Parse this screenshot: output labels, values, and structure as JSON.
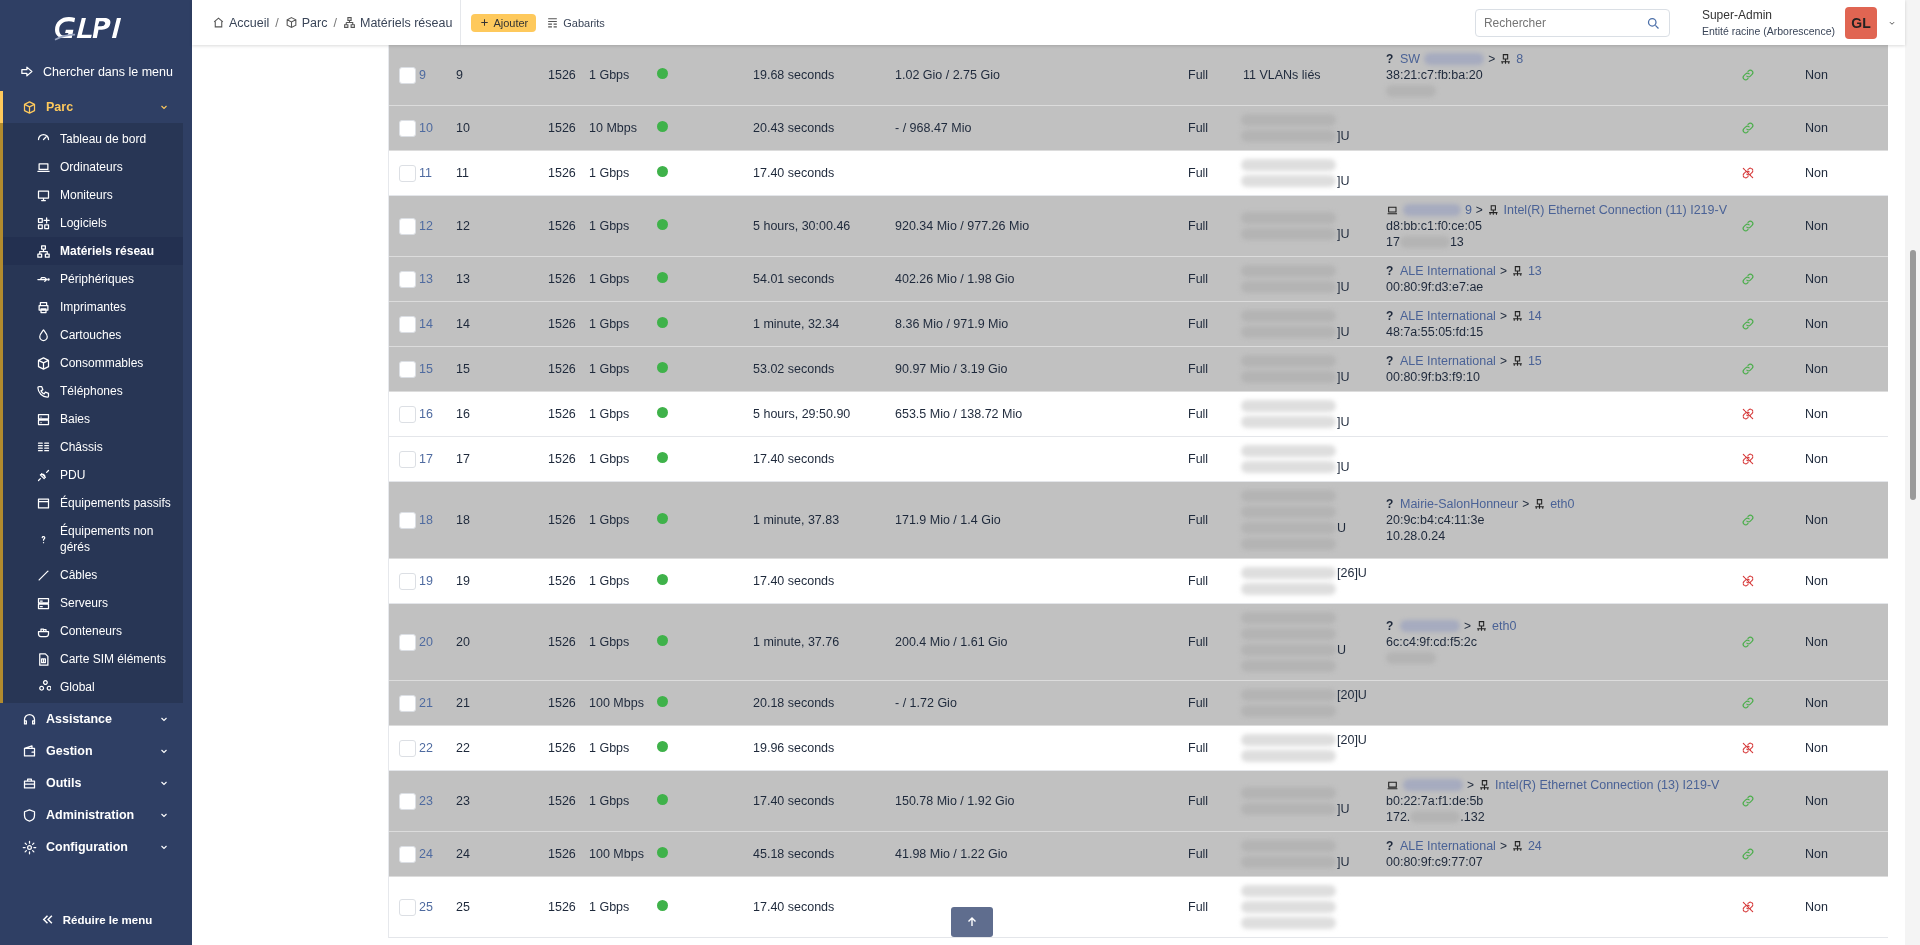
{
  "sidebar": {
    "search": "Chercher dans le menu",
    "sections": [
      {
        "label": "Parc",
        "expanded": true,
        "children": [
          {
            "label": "Tableau de bord",
            "selected": false
          },
          {
            "label": "Ordinateurs",
            "selected": false
          },
          {
            "label": "Moniteurs",
            "selected": false
          },
          {
            "label": "Logiciels",
            "selected": false
          },
          {
            "label": "Matériels réseau",
            "selected": true
          },
          {
            "label": "Périphériques",
            "selected": false
          },
          {
            "label": "Imprimantes",
            "selected": false
          },
          {
            "label": "Cartouches",
            "selected": false
          },
          {
            "label": "Consommables",
            "selected": false
          },
          {
            "label": "Téléphones",
            "selected": false
          },
          {
            "label": "Baies",
            "selected": false
          },
          {
            "label": "Châssis",
            "selected": false
          },
          {
            "label": "PDU",
            "selected": false
          },
          {
            "label": "Équipements passifs",
            "selected": false
          },
          {
            "label": "Équipements non gérés",
            "selected": false
          },
          {
            "label": "Câbles",
            "selected": false
          },
          {
            "label": "Serveurs",
            "selected": false
          },
          {
            "label": "Conteneurs",
            "selected": false
          },
          {
            "label": "Carte SIM éléments",
            "selected": false
          },
          {
            "label": "Global",
            "selected": false
          }
        ]
      },
      {
        "label": "Assistance",
        "expanded": false
      },
      {
        "label": "Gestion",
        "expanded": false
      },
      {
        "label": "Outils",
        "expanded": false
      },
      {
        "label": "Administration",
        "expanded": false
      },
      {
        "label": "Configuration",
        "expanded": false
      }
    ],
    "collapse": "Réduire le menu"
  },
  "header": {
    "breadcrumb": [
      {
        "label": "Accueil"
      },
      {
        "separator": "/",
        "label": "Parc"
      },
      {
        "separator": "/",
        "label": "Matériels réseau"
      }
    ],
    "add_button": "Ajouter",
    "templates": "Gabarits",
    "search": {
      "placeholder": "Rechercher"
    },
    "user": {
      "name": "Super-Admin",
      "entity": "Entité racine (Arborescence)",
      "initials": "GL"
    }
  },
  "rows": [
    {
      "id": "9",
      "checked": false,
      "name": "9",
      "mtu": "1526",
      "speed": "1 Gbps",
      "up": true,
      "duration": "19.68 seconds",
      "traffic": "1.02 Gio / 2.75 Gio",
      "duplex": "Full",
      "connected": true,
      "vlan": {
        "kind": "text",
        "text": "11 VLANs liés"
      },
      "connection": {
        "marker": "?",
        "device": [
          {
            "text": "SW"
          },
          {
            "redacted": true
          }
        ],
        "separator": ">",
        "port": "8",
        "mac": "38:21:c7:fb:ba:20",
        "ip": [
          {
            "redacted": true
          }
        ]
      },
      "autoneg": "Non"
    },
    {
      "id": "10",
      "checked": false,
      "name": "10",
      "mtu": "1526",
      "speed": "10 Mbps",
      "up": true,
      "duration": "20.43 seconds",
      "traffic": "- / 968.47 Mio",
      "duplex": "Full",
      "connected": true,
      "vlan": {
        "kind": "redacted",
        "lines": [
          {
            "redacted": true
          },
          {
            "redacted": true,
            "suffix": "]U"
          }
        ]
      },
      "autoneg": "Non"
    },
    {
      "id": "11",
      "checked": false,
      "name": "11",
      "mtu": "1526",
      "speed": "1 Gbps",
      "up": true,
      "duration": "17.40 seconds",
      "duplex": "Full",
      "connected": false,
      "vlan": {
        "kind": "redacted",
        "lines": [
          {
            "redacted": true
          },
          {
            "redacted": true,
            "suffix": "]U"
          }
        ]
      },
      "autoneg": "Non"
    },
    {
      "id": "12",
      "checked": false,
      "name": "12",
      "mtu": "1526",
      "speed": "1 Gbps",
      "up": true,
      "duration": "5 hours, 30:00.46",
      "traffic": "920.34 Mio / 977.26 Mio",
      "duplex": "Full",
      "connected": true,
      "vlan": {
        "kind": "redacted",
        "lines": [
          {
            "redacted": true
          },
          {
            "redacted": true,
            "suffix": "]U"
          }
        ]
      },
      "connection": {
        "computer": true,
        "device": [
          {
            "redacted": true
          },
          {
            "text": "9"
          }
        ],
        "separator": ">",
        "port": "Intel(R) Ethernet Connection (11) I219-V",
        "mac": "d8:bb:c1:f0:ce:05",
        "ip": [
          {
            "text": "17"
          },
          {
            "redacted": true
          },
          {
            "text": "13"
          }
        ]
      },
      "autoneg": "Non"
    },
    {
      "id": "13",
      "checked": false,
      "name": "13",
      "mtu": "1526",
      "speed": "1 Gbps",
      "up": true,
      "duration": "54.01 seconds",
      "traffic": "402.26 Mio / 1.98 Gio",
      "duplex": "Full",
      "connected": true,
      "vlan": {
        "kind": "redacted",
        "lines": [
          {
            "redacted": true
          },
          {
            "redacted": true,
            "suffix": "]U"
          }
        ]
      },
      "connection": {
        "marker": "?",
        "device": [
          {
            "text": "ALE International"
          }
        ],
        "separator": ">",
        "port": "13",
        "mac": "00:80:9f:d3:e7:ae"
      },
      "autoneg": "Non"
    },
    {
      "id": "14",
      "checked": false,
      "name": "14",
      "mtu": "1526",
      "speed": "1 Gbps",
      "up": true,
      "duration": "1 minute, 32.34",
      "traffic": "8.36 Mio / 971.9 Mio",
      "duplex": "Full",
      "connected": true,
      "vlan": {
        "kind": "redacted",
        "lines": [
          {
            "redacted": true
          },
          {
            "redacted": true,
            "suffix": "]U"
          }
        ]
      },
      "connection": {
        "marker": "?",
        "device": [
          {
            "text": "ALE International"
          }
        ],
        "separator": ">",
        "port": "14",
        "mac": "48:7a:55:05:fd:15"
      },
      "autoneg": "Non"
    },
    {
      "id": "15",
      "checked": false,
      "name": "15",
      "mtu": "1526",
      "speed": "1 Gbps",
      "up": true,
      "duration": "53.02 seconds",
      "traffic": "90.97 Mio / 3.19 Gio",
      "duplex": "Full",
      "connected": true,
      "vlan": {
        "kind": "redacted",
        "lines": [
          {
            "redacted": true
          },
          {
            "redacted": true,
            "suffix": "]U"
          }
        ]
      },
      "connection": {
        "marker": "?",
        "device": [
          {
            "text": "ALE International"
          }
        ],
        "separator": ">",
        "port": "15",
        "mac": "00:80:9f:b3:f9:10"
      },
      "autoneg": "Non"
    },
    {
      "id": "16",
      "checked": false,
      "name": "16",
      "mtu": "1526",
      "speed": "1 Gbps",
      "up": true,
      "duration": "5 hours, 29:50.90",
      "traffic": "653.5 Mio / 138.72 Mio",
      "duplex": "Full",
      "connected": false,
      "vlan": {
        "kind": "redacted",
        "lines": [
          {
            "redacted": true
          },
          {
            "redacted": true,
            "suffix": "]U"
          }
        ]
      },
      "autoneg": "Non"
    },
    {
      "id": "17",
      "checked": false,
      "name": "17",
      "mtu": "1526",
      "speed": "1 Gbps",
      "up": true,
      "duration": "17.40 seconds",
      "duplex": "Full",
      "connected": false,
      "vlan": {
        "kind": "redacted",
        "lines": [
          {
            "redacted": true
          },
          {
            "redacted": true,
            "suffix": "]U"
          }
        ]
      },
      "autoneg": "Non"
    },
    {
      "id": "18",
      "checked": false,
      "name": "18",
      "mtu": "1526",
      "speed": "1 Gbps",
      "up": true,
      "duration": "1 minute, 37.83",
      "traffic": "171.9 Mio / 1.4 Gio",
      "duplex": "Full",
      "connected": true,
      "vlan": {
        "kind": "redacted",
        "lines": [
          {
            "redacted": true
          },
          {
            "redacted": true
          },
          {
            "redacted": true,
            "suffix": "U"
          },
          {
            "redacted": true
          }
        ]
      },
      "connection": {
        "marker": "?",
        "device": [
          {
            "text": "Mairie-SalonHonneur"
          }
        ],
        "separator": ">",
        "port": "eth0",
        "mac": "20:9c:b4:c4:11:3e",
        "ip": [
          {
            "text": "10.28.0.24"
          }
        ]
      },
      "autoneg": "Non"
    },
    {
      "id": "19",
      "checked": false,
      "name": "19",
      "mtu": "1526",
      "speed": "1 Gbps",
      "up": true,
      "duration": "17.40 seconds",
      "duplex": "Full",
      "connected": false,
      "vlan": {
        "kind": "redacted",
        "lines": [
          {
            "redacted": true,
            "suffix": "[26]U"
          },
          {
            "redacted": true
          }
        ]
      },
      "autoneg": "Non"
    },
    {
      "id": "20",
      "checked": false,
      "name": "20",
      "mtu": "1526",
      "speed": "1 Gbps",
      "up": true,
      "duration": "1 minute, 37.76",
      "traffic": "200.4 Mio / 1.61 Gio",
      "duplex": "Full",
      "connected": true,
      "vlan": {
        "kind": "redacted",
        "lines": [
          {
            "redacted": true
          },
          {
            "redacted": true
          },
          {
            "redacted": true,
            "suffix": "U"
          },
          {
            "redacted": true
          }
        ]
      },
      "connection": {
        "marker": "?",
        "device": [
          {
            "redacted": true
          }
        ],
        "separator": ">",
        "port": "eth0",
        "mac": "6c:c4:9f:cd:f5:2c",
        "ip": [
          {
            "redacted": true
          }
        ]
      },
      "autoneg": "Non"
    },
    {
      "id": "21",
      "checked": false,
      "name": "21",
      "mtu": "1526",
      "speed": "100 Mbps",
      "up": true,
      "duration": "20.18 seconds",
      "traffic": "- / 1.72 Gio",
      "duplex": "Full",
      "connected": true,
      "vlan": {
        "kind": "redacted",
        "lines": [
          {
            "redacted": true,
            "suffix": "[20]U"
          },
          {
            "redacted": true
          }
        ]
      },
      "autoneg": "Non"
    },
    {
      "id": "22",
      "checked": false,
      "name": "22",
      "mtu": "1526",
      "speed": "1 Gbps",
      "up": true,
      "duration": "19.96 seconds",
      "duplex": "Full",
      "connected": false,
      "vlan": {
        "kind": "redacted",
        "lines": [
          {
            "redacted": true,
            "suffix": "[20]U"
          },
          {
            "redacted": true
          }
        ]
      },
      "autoneg": "Non"
    },
    {
      "id": "23",
      "checked": false,
      "name": "23",
      "mtu": "1526",
      "speed": "1 Gbps",
      "up": true,
      "duration": "17.40 seconds",
      "traffic": "150.78 Mio / 1.92 Gio",
      "duplex": "Full",
      "connected": true,
      "vlan": {
        "kind": "redacted",
        "lines": [
          {
            "redacted": true
          },
          {
            "redacted": true,
            "suffix": "]U"
          }
        ]
      },
      "connection": {
        "computer": true,
        "device": [
          {
            "redacted": true
          }
        ],
        "separator": ">",
        "port": "Intel(R) Ethernet Connection (13) I219-V",
        "mac": "b0:22:7a:f1:de:5b",
        "ip": [
          {
            "text": "172."
          },
          {
            "redacted": true
          },
          {
            "text": ".132"
          }
        ]
      },
      "autoneg": "Non"
    },
    {
      "id": "24",
      "checked": false,
      "name": "24",
      "mtu": "1526",
      "speed": "100 Mbps",
      "up": true,
      "duration": "45.18 seconds",
      "traffic": "41.98 Mio / 1.22 Gio",
      "duplex": "Full",
      "connected": true,
      "vlan": {
        "kind": "redacted",
        "lines": [
          {
            "redacted": true
          },
          {
            "redacted": true,
            "suffix": "]U"
          }
        ]
      },
      "connection": {
        "marker": "?",
        "device": [
          {
            "text": "ALE International"
          }
        ],
        "separator": ">",
        "port": "24",
        "mac": "00:80:9f:c9:77:07"
      },
      "autoneg": "Non"
    },
    {
      "id": "25",
      "checked": false,
      "name": "25",
      "mtu": "1526",
      "speed": "1 Gbps",
      "up": true,
      "duration": "17.40 seconds",
      "duplex": "Full",
      "connected": false,
      "vlan": {
        "kind": "redacted",
        "lines": [
          {
            "redacted": true
          },
          {
            "redacted": true
          },
          {
            "redacted": true
          }
        ]
      },
      "autoneg": "Non"
    }
  ]
}
